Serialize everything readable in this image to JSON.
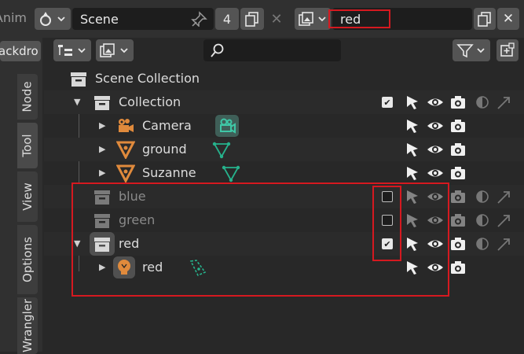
{
  "header": {
    "editor_label": "Anim",
    "scene_name": "Scene",
    "scene_users": "4",
    "view_layer": "red"
  },
  "sidebar": {
    "cut_label": "ackdro",
    "tabs": [
      "Node",
      "Tool",
      "View",
      "Options",
      "Wrangler"
    ]
  },
  "outliner": {
    "search_placeholder": "",
    "root": "Scene Collection",
    "rows": [
      {
        "name": "Collection",
        "kind": "collection",
        "checked": true
      },
      {
        "name": "Camera",
        "kind": "camera"
      },
      {
        "name": "ground",
        "kind": "mesh"
      },
      {
        "name": "Suzanne",
        "kind": "mesh"
      },
      {
        "name": "blue",
        "kind": "collection",
        "checked": false,
        "excluded": true
      },
      {
        "name": "green",
        "kind": "collection",
        "checked": false,
        "excluded": true
      },
      {
        "name": "red",
        "kind": "collection",
        "checked": true
      },
      {
        "name": "red",
        "kind": "light"
      }
    ]
  },
  "colors": {
    "highlight": "#d51920",
    "camera_data": "#3a9b88",
    "mesh_data": "#26b28c",
    "object_orange": "#e08a3c"
  }
}
